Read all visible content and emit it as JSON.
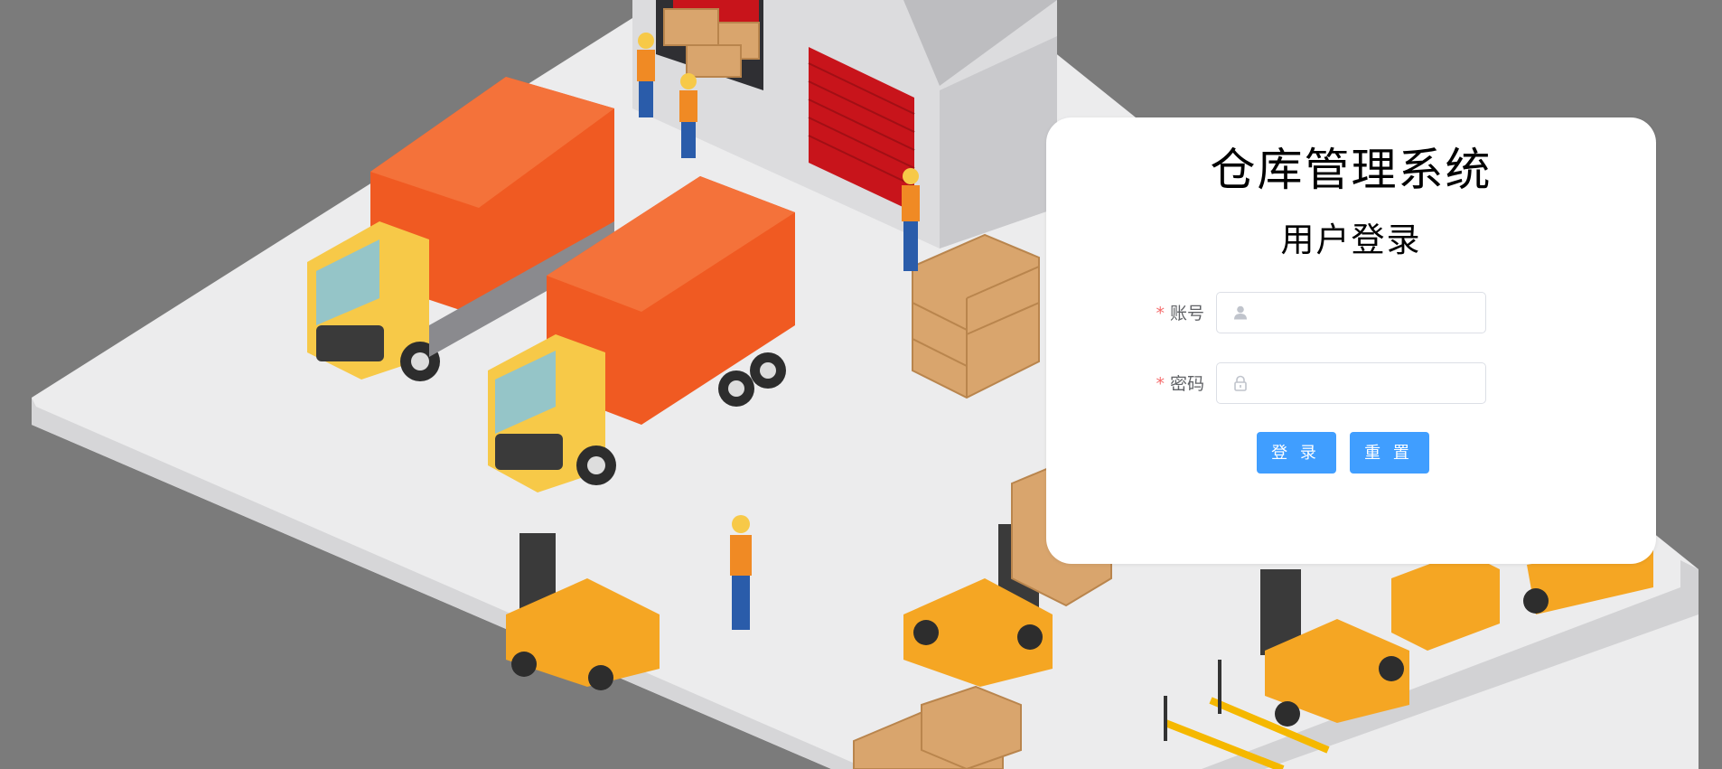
{
  "login": {
    "title": "仓库管理系统",
    "subtitle": "用户登录",
    "required_mark": "*",
    "username": {
      "label": "账号",
      "value": "",
      "placeholder": "",
      "icon": "user-icon"
    },
    "password": {
      "label": "密码",
      "value": "",
      "placeholder": "",
      "icon": "lock-icon"
    },
    "login_button": "登 录",
    "reset_button": "重 置"
  },
  "colors": {
    "background": "#7b7b7b",
    "card": "#ffffff",
    "primary_button": "#409eff",
    "required_mark": "#f56c6c",
    "truck_cargo": "#f05a22",
    "truck_cab": "#f7c948",
    "forklift": "#f5a623",
    "warehouse_door": "#c8141b",
    "floor": "#e9e9ea",
    "boxes": "#d9a56d"
  },
  "illustration": {
    "icon": "warehouse-illustration"
  }
}
